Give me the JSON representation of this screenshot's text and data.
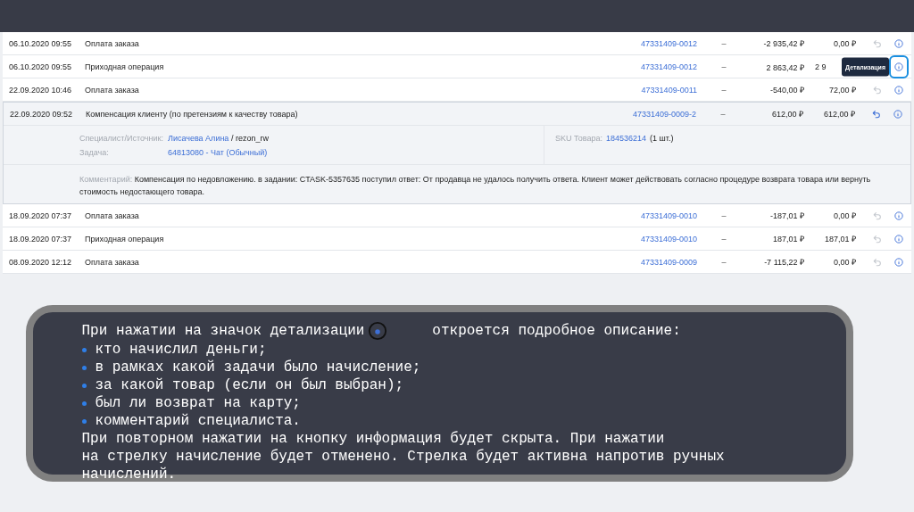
{
  "table": {
    "rows": [
      {
        "date": "06.10.2020 09:55",
        "operation": "Оплата заказа",
        "order": "47331409-0012",
        "dash": "–",
        "amount": "-2 935,42 ₽",
        "balance": "0,00 ₽",
        "return_active": false,
        "info_selected": false,
        "expanded": false
      },
      {
        "date": "06.10.2020 09:55",
        "operation": "Приходная операция",
        "order": "47331409-0012",
        "dash": "–",
        "amount": "2 863,42 ₽",
        "balance": "2 9",
        "return_active": false,
        "info_selected": true,
        "tooltip": "Детализация",
        "expanded": false
      },
      {
        "date": "22.09.2020 10:46",
        "operation": "Оплата заказа",
        "order": "47331409-0011",
        "dash": "–",
        "amount": "-540,00 ₽",
        "balance": "72,00 ₽",
        "return_active": false,
        "info_selected": false,
        "expanded": false
      },
      {
        "date": "22.09.2020 09:52",
        "operation": "Компенсация клиенту (по претензиям к качеству товара)",
        "order": "47331409-0009-2",
        "dash": "–",
        "amount": "612,00 ₽",
        "balance": "612,00 ₽",
        "return_active": true,
        "info_selected": false,
        "expanded": true,
        "details": {
          "specialist_label": "Специалист/Источник:",
          "specialist_link": "Лисачева Алина",
          "specialist_rest": " / rezon_rw",
          "task_label": "Задача:",
          "task_link": "64813080 - Чат (Обычный)",
          "sku_label": "SKU Товара:",
          "sku_link": "184536214",
          "sku_rest": "(1 шт.)",
          "comment_label": "Комментарий:",
          "comment": "Компенсация по недовложению. в задании: CTASK-5357635 поступил ответ: От продавца не удалось получить ответа. Клиент может действовать согласно процедуре возврата товара или вернуть стоимость недостающего товара."
        }
      },
      {
        "date": "18.09.2020 07:37",
        "operation": "Оплата заказа",
        "order": "47331409-0010",
        "dash": "–",
        "amount": "-187,01 ₽",
        "balance": "0,00 ₽",
        "return_active": false,
        "info_selected": false,
        "expanded": false
      },
      {
        "date": "18.09.2020 07:37",
        "operation": "Приходная операция",
        "order": "47331409-0010",
        "dash": "–",
        "amount": "187,01 ₽",
        "balance": "187,01 ₽",
        "return_active": false,
        "info_selected": false,
        "expanded": false
      },
      {
        "date": "08.09.2020 12:12",
        "operation": "Оплата заказа",
        "order": "47331409-0009",
        "dash": "–",
        "amount": "-7 115,22 ₽",
        "balance": "0,00 ₽",
        "return_active": false,
        "info_selected": false,
        "expanded": false
      }
    ]
  },
  "note": {
    "intro": "При нажатии на значок детализации",
    "intro_end": "откроется подробное описание:",
    "bullets": [
      "кто начислил деньги;",
      "в рамках какой задачи было начисление;",
      "за какой товар (если он был выбран);",
      "был ли возврат на карту;",
      "комментарий специалиста."
    ],
    "lines": [
      "При повторном нажатии на кнопку информация будет скрыта. При нажатии",
      "на стрелку начисление будет отменено. Стрелка будет активна напротив ручных",
      "начислений."
    ]
  }
}
